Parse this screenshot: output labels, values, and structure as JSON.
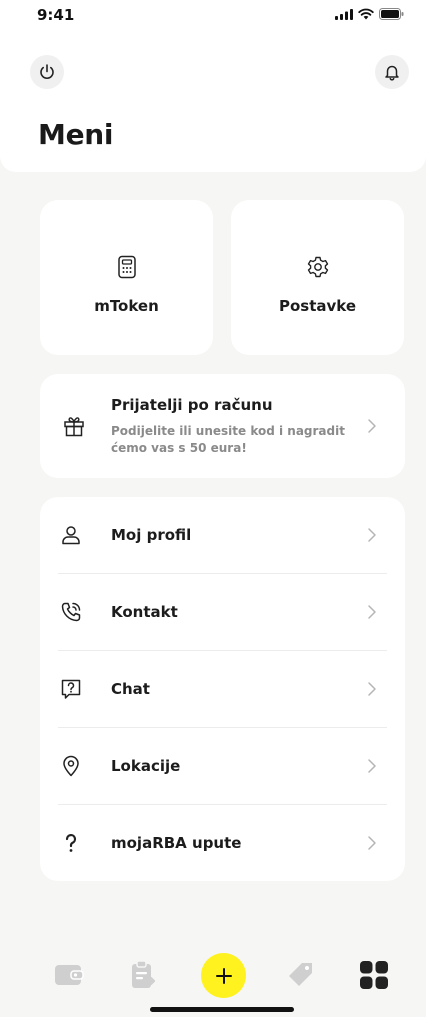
{
  "status_bar": {
    "time": "9:41",
    "signal_icon": "cellular-signal-icon",
    "wifi_icon": "wifi-icon",
    "battery_icon": "battery-icon"
  },
  "header": {
    "title": "Meni",
    "power_icon": "power-icon",
    "bell_icon": "bell-icon"
  },
  "tiles": [
    {
      "label": "mToken",
      "icon": "calculator-icon"
    },
    {
      "label": "Postavke",
      "icon": "gear-icon"
    }
  ],
  "referral": {
    "title": "Prijatelji po računu",
    "subtitle": "Podijelite ili unesite kod i nagradit ćemo vas s 50 eura!",
    "icon": "gift-icon"
  },
  "menu": [
    {
      "label": "Moj profil",
      "icon": "user-icon"
    },
    {
      "label": "Kontakt",
      "icon": "phone-icon"
    },
    {
      "label": "Chat",
      "icon": "chat-question-icon"
    },
    {
      "label": "Lokacije",
      "icon": "location-pin-icon"
    },
    {
      "label": "mojaRBA upute",
      "icon": "question-mark-icon"
    }
  ],
  "bottom_nav": {
    "items": [
      "wallet-icon",
      "clipboard-icon",
      "plus-icon",
      "tag-icon",
      "grid-icon"
    ],
    "fab_label": "+",
    "accent": "#fff21f"
  },
  "colors": {
    "background": "#f6f6f4",
    "card": "#ffffff",
    "inactive_icon": "#cfcfcf",
    "accent": "#fff21f"
  }
}
